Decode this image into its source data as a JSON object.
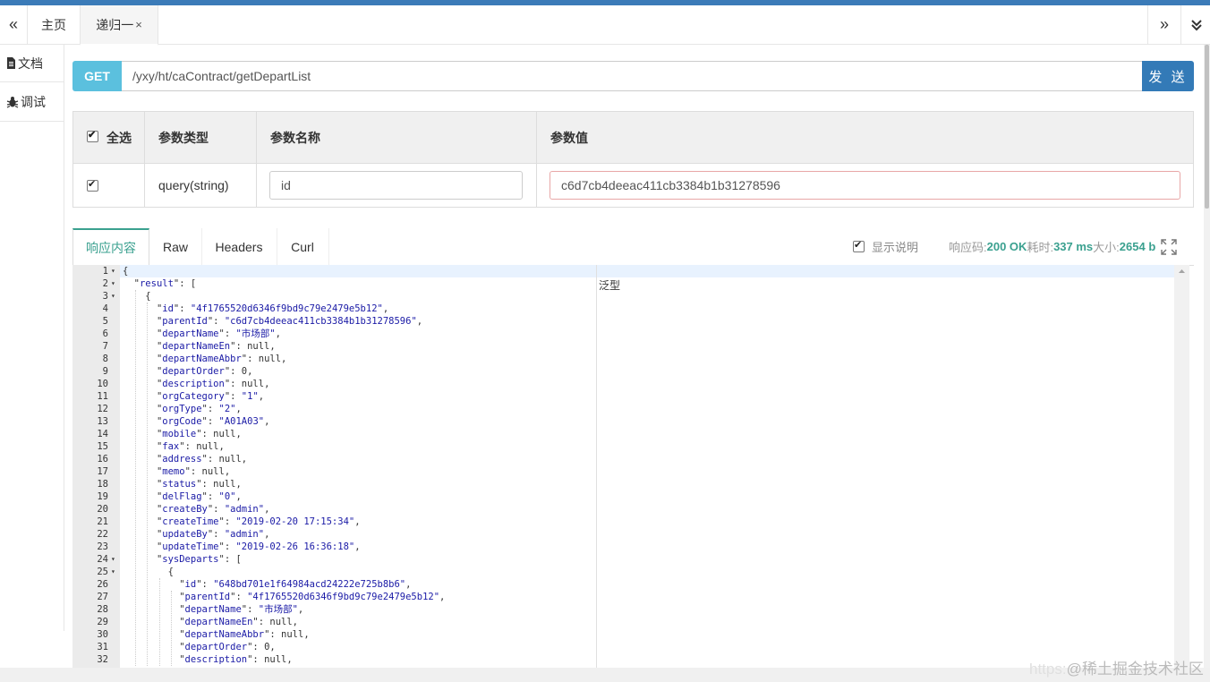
{
  "tabs": {
    "left_nav": "«",
    "home": "主页",
    "active": "递归一",
    "close": "×",
    "right_nav": "»",
    "down_nav": "⌄"
  },
  "sidebar": {
    "items": [
      {
        "label": "文档",
        "icon": "document-icon"
      },
      {
        "label": "调试",
        "icon": "bug-icon"
      }
    ]
  },
  "request": {
    "method": "GET",
    "url": "/yxy/ht/caContract/getDepartList",
    "send_label": "发 送"
  },
  "params": {
    "headers": [
      "全选",
      "参数类型",
      "参数名称",
      "参数值"
    ],
    "rows": [
      {
        "checked": true,
        "type": "query(string)",
        "name": "id",
        "value": "c6d7cb4deeac411cb3384b1b31278596"
      }
    ]
  },
  "response": {
    "tabs": [
      "响应内容",
      "Raw",
      "Headers",
      "Curl"
    ],
    "show_desc_label": "显示说明",
    "code_label": "响应码:",
    "code_value": "200 OK",
    "time_label": "耗时:",
    "time_value": "337 ms",
    "size_label": "大小:",
    "size_value": "2654 b",
    "desc_text": "泛型"
  },
  "code_lines": [
    "{",
    "  \"result\": [",
    "    {",
    "      \"id\": \"4f1765520d6346f9bd9c79e2479e5b12\",",
    "      \"parentId\": \"c6d7cb4deeac411cb3384b1b31278596\",",
    "      \"departName\": \"市场部\",",
    "      \"departNameEn\": null,",
    "      \"departNameAbbr\": null,",
    "      \"departOrder\": 0,",
    "      \"description\": null,",
    "      \"orgCategory\": \"1\",",
    "      \"orgType\": \"2\",",
    "      \"orgCode\": \"A01A03\",",
    "      \"mobile\": null,",
    "      \"fax\": null,",
    "      \"address\": null,",
    "      \"memo\": null,",
    "      \"status\": null,",
    "      \"delFlag\": \"0\",",
    "      \"createBy\": \"admin\",",
    "      \"createTime\": \"2019-02-20 17:15:34\",",
    "      \"updateBy\": \"admin\",",
    "      \"updateTime\": \"2019-02-26 16:36:18\",",
    "      \"sysDeparts\": [",
    "        {",
    "          \"id\": \"648bd701e1f64984acd24222e725b8b6\",",
    "          \"parentId\": \"4f1765520d6346f9bd9c79e2479e5b12\",",
    "          \"departName\": \"市场部\",",
    "          \"departNameEn\": null,",
    "          \"departNameAbbr\": null,",
    "          \"departOrder\": 0,",
    "          \"description\": null,"
  ],
  "fold_lines": [
    1,
    2,
    3,
    24,
    25
  ],
  "watermark": {
    "prefix": "https:",
    "text": "@稀土掘金技术社区"
  }
}
